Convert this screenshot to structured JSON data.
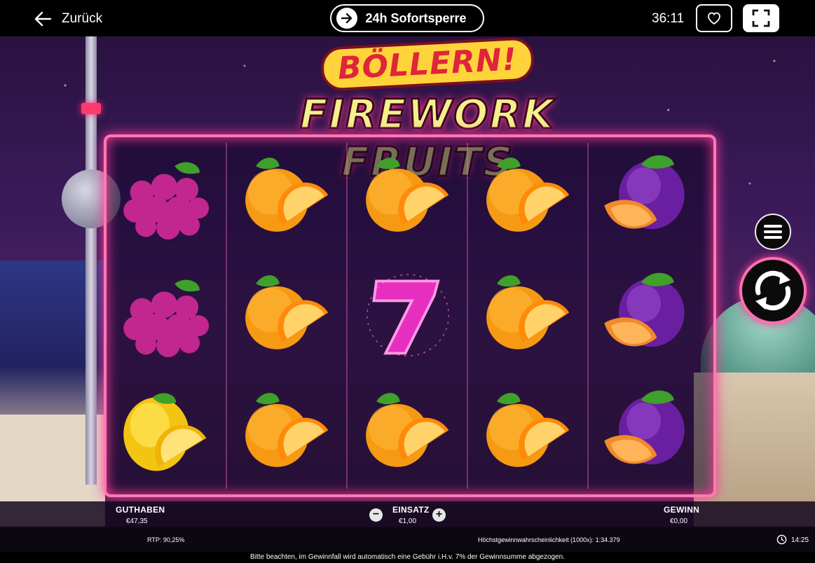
{
  "topbar": {
    "back_label": "Zurück",
    "sofort_label": "24h Sofortsperre",
    "timer": "36:11"
  },
  "game": {
    "title_line1": "BÖLLERN!",
    "title_line2": "FIREWORK FRUITS",
    "reels": [
      [
        "grapes",
        "grapes",
        "lemon"
      ],
      [
        "orange",
        "orange",
        "orange"
      ],
      [
        "orange",
        "seven",
        "orange"
      ],
      [
        "orange",
        "orange",
        "orange"
      ],
      [
        "plum",
        "plum",
        "plum"
      ]
    ]
  },
  "hud": {
    "balance_label": "GUTHABEN",
    "balance_value": "€47,35",
    "bet_label": "EINSATZ",
    "bet_value": "€1,00",
    "win_label": "GEWINN",
    "win_value": "€0,00",
    "minus": "−",
    "plus": "+"
  },
  "info": {
    "rtp": "RTP: 90,25%",
    "probability": "Höchstgewinnwahrscheinlichkeit (1000x): 1:34.379",
    "time": "14:25",
    "notice": "Bitte beachten, im Gewinnfall wird automatisch eine Gebühr i.H.v. 7% der Gewinnsumme abgezogen."
  },
  "colors": {
    "frame": "#ff79b4",
    "background": "#3b1a5a"
  },
  "icons": [
    "arrow-left-icon",
    "arrow-right-icon",
    "heart-icon",
    "fullscreen-icon",
    "menu-icon",
    "spin-icon",
    "clock-icon"
  ]
}
